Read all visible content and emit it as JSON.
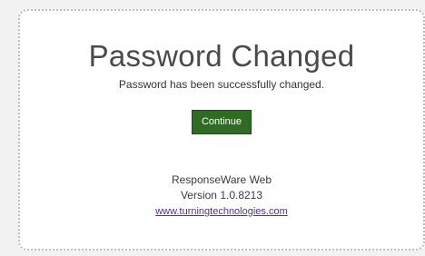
{
  "dialog": {
    "title": "Password Changed",
    "message": "Password has been successfully changed.",
    "continue_label": "Continue"
  },
  "footer": {
    "product_name": "ResponseWare Web",
    "version": "Version 1.0.8213",
    "link_text": "www.turningtechnologies.com"
  },
  "colors": {
    "button_bg": "#2f6b23",
    "link": "#5b2d91",
    "border": "#bdbdbd"
  }
}
